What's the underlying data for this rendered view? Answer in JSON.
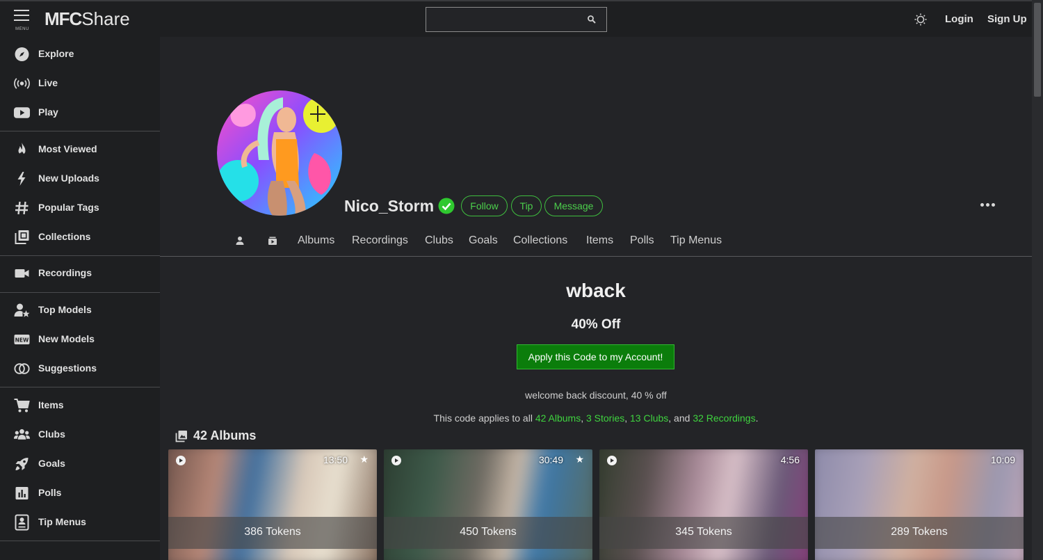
{
  "header": {
    "menu_label": "MENU",
    "logo_bold": "MFC",
    "logo_light": "Share",
    "search_value": "",
    "login_label": "Login",
    "signup_label": "Sign Up"
  },
  "sidebar": {
    "items": [
      {
        "label": "Explore",
        "icon": "compass-icon"
      },
      {
        "label": "Live",
        "icon": "broadcast-icon"
      },
      {
        "label": "Play",
        "icon": "play-icon"
      },
      {
        "label": "Most Viewed",
        "icon": "flame-icon"
      },
      {
        "label": "New Uploads",
        "icon": "lightning-icon"
      },
      {
        "label": "Popular Tags",
        "icon": "hashtag-icon"
      },
      {
        "label": "Collections",
        "icon": "collections-icon"
      },
      {
        "label": "Recordings",
        "icon": "video-camera-icon"
      },
      {
        "label": "Top Models",
        "icon": "user-star-icon"
      },
      {
        "label": "New Models",
        "icon": "new-badge-icon"
      },
      {
        "label": "Suggestions",
        "icon": "rings-icon"
      },
      {
        "label": "Items",
        "icon": "cart-icon"
      },
      {
        "label": "Clubs",
        "icon": "group-icon"
      },
      {
        "label": "Goals",
        "icon": "rocket-icon"
      },
      {
        "label": "Polls",
        "icon": "poll-icon"
      },
      {
        "label": "Tip Menus",
        "icon": "tip-menu-icon"
      }
    ]
  },
  "profile": {
    "username": "Nico_Storm",
    "follow_label": "Follow",
    "tip_label": "Tip",
    "message_label": "Message",
    "tabs": [
      "Albums",
      "Recordings",
      "Clubs",
      "Goals",
      "Collections",
      "Items",
      "Polls",
      "Tip Menus"
    ]
  },
  "promo": {
    "code": "wback",
    "discount": "40% Off",
    "apply_label": "Apply this Code to my Account!",
    "description": "welcome back discount, 40 % off",
    "applies_prefix": "This code applies to all",
    "albums_link": "42 Albums",
    "stories_link": "3 Stories",
    "clubs_link": "13 Clubs",
    "and_text": ", and",
    "recordings_link": "32 Recordings",
    "comma": ","
  },
  "albums": {
    "heading": "42 Albums",
    "cards": [
      {
        "duration": "13:50",
        "price": "386 Tokens",
        "starred": true
      },
      {
        "duration": "30:49",
        "price": "450 Tokens",
        "starred": true
      },
      {
        "duration": "4:56",
        "price": "345 Tokens",
        "starred": false
      },
      {
        "duration": "10:09",
        "price": "289 Tokens",
        "starred": false
      }
    ]
  },
  "colors": {
    "accent_green": "#3fd43f",
    "apply_button": "#0b7d0b",
    "background": "#232427",
    "sidebar": "#1e1f21"
  }
}
